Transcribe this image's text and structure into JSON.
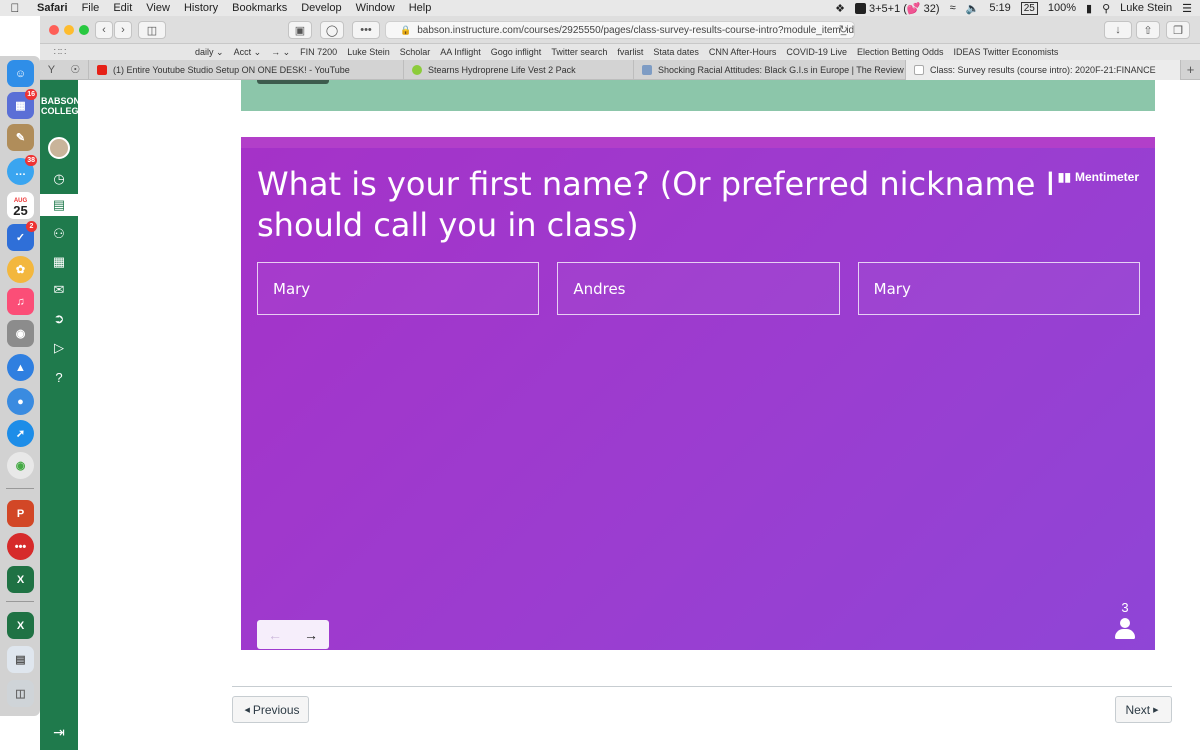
{
  "menubar": {
    "app_name": "Safari",
    "items": [
      "File",
      "Edit",
      "View",
      "History",
      "Bookmarks",
      "Develop",
      "Window",
      "Help"
    ],
    "status_counter": "3+5+1 (💕 32)",
    "time": "5:19",
    "calendar_date": "25",
    "battery": "100%",
    "user_name": "Luke Stein"
  },
  "browser": {
    "url": "babson.instructure.com/courses/2925550/pages/class-survey-results-course-intro?module_item_id=6",
    "bookmarks": [
      "daily ⌄",
      "Acct ⌄",
      "→ ⌄",
      "FIN 7200",
      "Luke Stein",
      "Scholar",
      "AA Inflight",
      "Gogo inflight",
      "Twitter search",
      "fvarlist",
      "Stata dates",
      "CNN After-Hours",
      "COVID-19 Live",
      "Election Betting Odds",
      "IDEAS Twitter Economists"
    ],
    "tabs": [
      {
        "label": "(1) Entire Youtube Studio Setup ON ONE DESK! - YouTube",
        "active": false
      },
      {
        "label": "Stearns Hydroprene Life Vest 2 Pack",
        "active": false
      },
      {
        "label": "Shocking Racial Attitudes: Black G.I.s in Europe | The Review o...",
        "active": false
      },
      {
        "label": "Class: Survey results (course intro): 2020F-21:FINANCE",
        "active": true
      }
    ]
  },
  "dock": {
    "calendar_month": "AUG",
    "calendar_day": "25",
    "badges": {
      "launchpad": "16",
      "messages": "38",
      "reminders": "2"
    }
  },
  "canvas": {
    "logo_line1": "BABSON",
    "logo_line2": "COLLEGE"
  },
  "mentimeter": {
    "question": "What is your first name? (Or preferred nickname I should call you in class)",
    "brand": "Mentimeter",
    "answers": [
      "Mary",
      "Andres",
      "Mary"
    ],
    "participant_count": "3"
  },
  "pager": {
    "previous_label": "Previous",
    "next_label": "Next"
  }
}
